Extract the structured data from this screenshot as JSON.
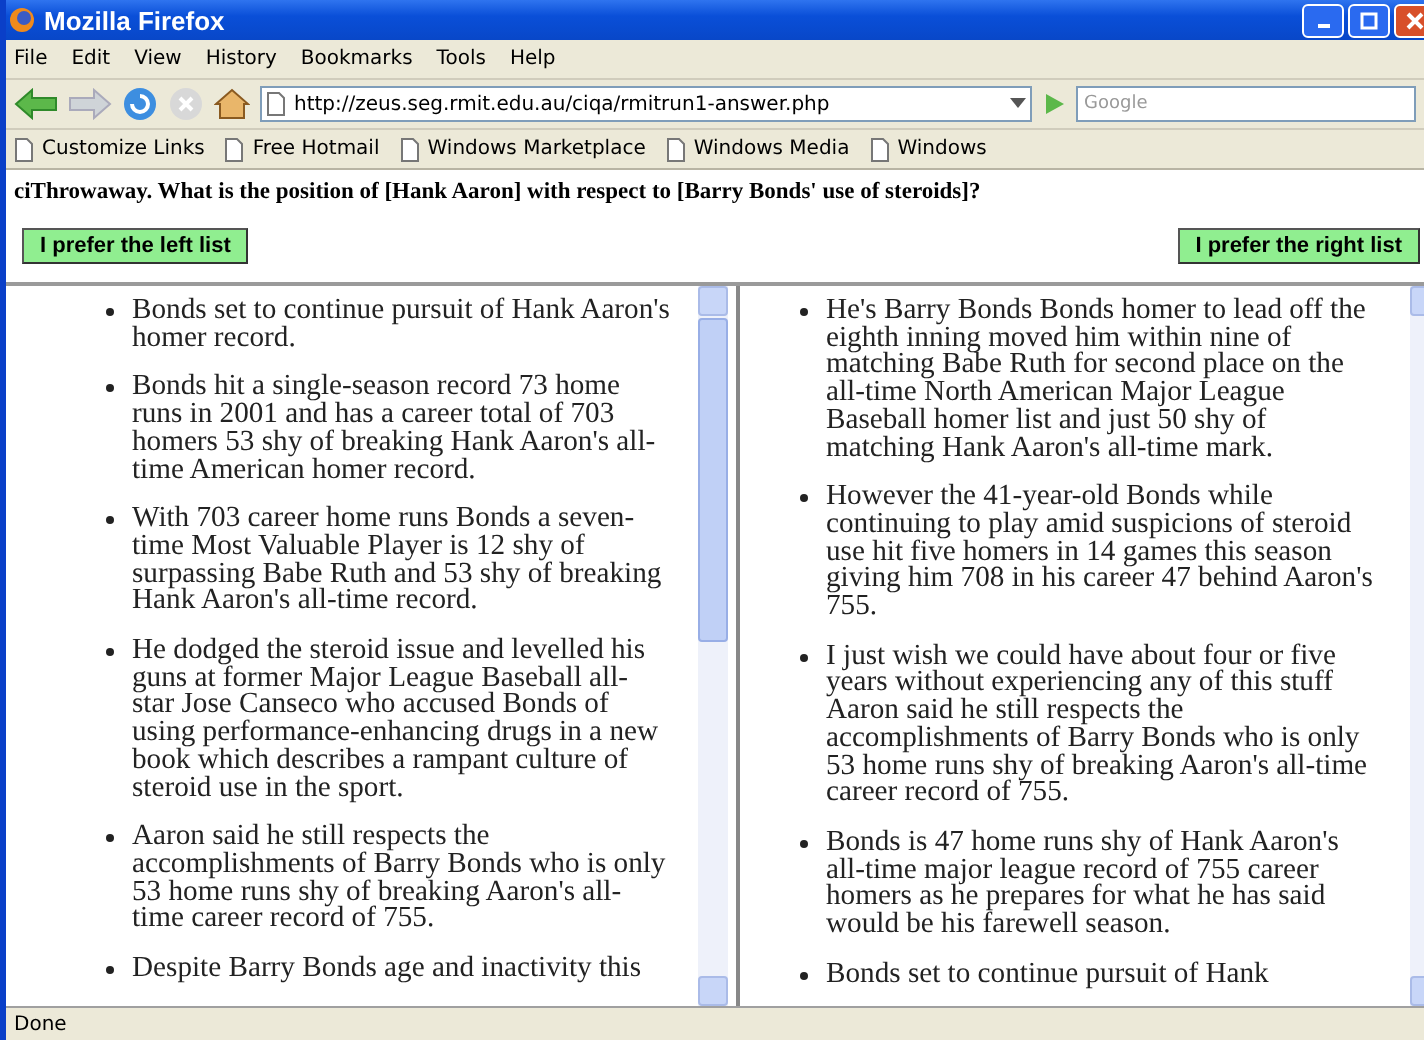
{
  "window": {
    "title": "Mozilla Firefox"
  },
  "menu": [
    "File",
    "Edit",
    "View",
    "History",
    "Bookmarks",
    "Tools",
    "Help"
  ],
  "address": {
    "url": "http://zeus.seg.rmit.edu.au/ciqa/rmitrun1-answer.php"
  },
  "search": {
    "placeholder": "Google"
  },
  "bookmarks": [
    "Customize Links",
    "Free Hotmail",
    "Windows Marketplace",
    "Windows Media",
    "Windows"
  ],
  "question": "ciThrowaway. What is the position of [Hank Aaron] with respect to [Barry Bonds' use of steroids]?",
  "buttons": [
    "I prefer the left list",
    "I prefer the right list"
  ],
  "frames": [
    {
      "items": [
        "Bonds set to continue pursuit of Hank Aaron's homer record.",
        "Bonds hit a single-season record 73 home runs in 2001 and has a career total of 703 homers 53 shy of breaking Hank Aaron's all-time American homer record.",
        "With 703 career home runs Bonds a seven-time Most Valuable Player is 12 shy of surpassing Babe Ruth and 53 shy of breaking Hank Aaron's all-time record.",
        "He dodged the steroid issue and levelled his guns at former Major League Baseball all-star Jose Canseco who accused Bonds of using performance-enhancing drugs in a new book which describes a rampant culture of steroid use in the sport.",
        "Aaron said he still respects the accomplishments of Barry Bonds who is only 53 home runs shy of breaking Aaron's all-time career record of 755.",
        "Despite Barry Bonds age and inactivity this"
      ]
    },
    {
      "items": [
        "He's Barry Bonds Bonds homer to lead off the eighth inning moved him within nine of matching Babe Ruth for second place on the all-time North American Major League Baseball homer list and just 50 shy of matching Hank Aaron's all-time mark.",
        "However the 41-year-old Bonds while continuing to play amid suspicions of steroid use hit five homers in 14 games this season giving him 708 in his career 47 behind Aaron's 755.",
        "I just wish we could have about four or five years without experiencing any of this stuff Aaron said he still respects the accomplishments of Barry Bonds who is only 53 home runs shy of breaking Aaron's all-time career record of 755.",
        "Bonds is 47 home runs shy of Hank Aaron's all-time major league record of 755 career homers as he prepares for what he has said would be his farewell season.",
        "Bonds set to continue pursuit of Hank"
      ]
    }
  ],
  "status_bar": "Done"
}
